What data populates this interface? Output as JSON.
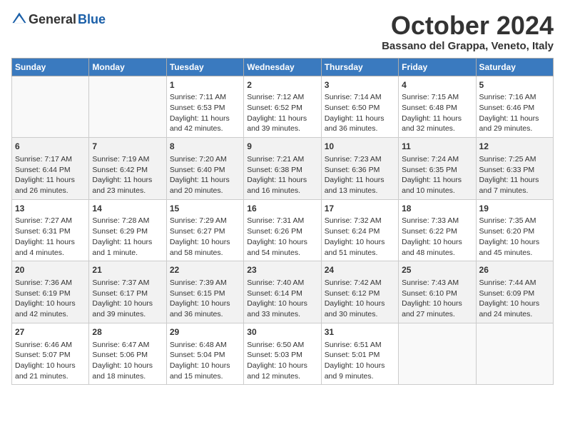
{
  "header": {
    "logo_general": "General",
    "logo_blue": "Blue",
    "month": "October 2024",
    "location": "Bassano del Grappa, Veneto, Italy"
  },
  "weekdays": [
    "Sunday",
    "Monday",
    "Tuesday",
    "Wednesday",
    "Thursday",
    "Friday",
    "Saturday"
  ],
  "weeks": [
    [
      {
        "day": "",
        "sunrise": "",
        "sunset": "",
        "daylight": ""
      },
      {
        "day": "",
        "sunrise": "",
        "sunset": "",
        "daylight": ""
      },
      {
        "day": "1",
        "sunrise": "Sunrise: 7:11 AM",
        "sunset": "Sunset: 6:53 PM",
        "daylight": "Daylight: 11 hours and 42 minutes."
      },
      {
        "day": "2",
        "sunrise": "Sunrise: 7:12 AM",
        "sunset": "Sunset: 6:52 PM",
        "daylight": "Daylight: 11 hours and 39 minutes."
      },
      {
        "day": "3",
        "sunrise": "Sunrise: 7:14 AM",
        "sunset": "Sunset: 6:50 PM",
        "daylight": "Daylight: 11 hours and 36 minutes."
      },
      {
        "day": "4",
        "sunrise": "Sunrise: 7:15 AM",
        "sunset": "Sunset: 6:48 PM",
        "daylight": "Daylight: 11 hours and 32 minutes."
      },
      {
        "day": "5",
        "sunrise": "Sunrise: 7:16 AM",
        "sunset": "Sunset: 6:46 PM",
        "daylight": "Daylight: 11 hours and 29 minutes."
      }
    ],
    [
      {
        "day": "6",
        "sunrise": "Sunrise: 7:17 AM",
        "sunset": "Sunset: 6:44 PM",
        "daylight": "Daylight: 11 hours and 26 minutes."
      },
      {
        "day": "7",
        "sunrise": "Sunrise: 7:19 AM",
        "sunset": "Sunset: 6:42 PM",
        "daylight": "Daylight: 11 hours and 23 minutes."
      },
      {
        "day": "8",
        "sunrise": "Sunrise: 7:20 AM",
        "sunset": "Sunset: 6:40 PM",
        "daylight": "Daylight: 11 hours and 20 minutes."
      },
      {
        "day": "9",
        "sunrise": "Sunrise: 7:21 AM",
        "sunset": "Sunset: 6:38 PM",
        "daylight": "Daylight: 11 hours and 16 minutes."
      },
      {
        "day": "10",
        "sunrise": "Sunrise: 7:23 AM",
        "sunset": "Sunset: 6:36 PM",
        "daylight": "Daylight: 11 hours and 13 minutes."
      },
      {
        "day": "11",
        "sunrise": "Sunrise: 7:24 AM",
        "sunset": "Sunset: 6:35 PM",
        "daylight": "Daylight: 11 hours and 10 minutes."
      },
      {
        "day": "12",
        "sunrise": "Sunrise: 7:25 AM",
        "sunset": "Sunset: 6:33 PM",
        "daylight": "Daylight: 11 hours and 7 minutes."
      }
    ],
    [
      {
        "day": "13",
        "sunrise": "Sunrise: 7:27 AM",
        "sunset": "Sunset: 6:31 PM",
        "daylight": "Daylight: 11 hours and 4 minutes."
      },
      {
        "day": "14",
        "sunrise": "Sunrise: 7:28 AM",
        "sunset": "Sunset: 6:29 PM",
        "daylight": "Daylight: 11 hours and 1 minute."
      },
      {
        "day": "15",
        "sunrise": "Sunrise: 7:29 AM",
        "sunset": "Sunset: 6:27 PM",
        "daylight": "Daylight: 10 hours and 58 minutes."
      },
      {
        "day": "16",
        "sunrise": "Sunrise: 7:31 AM",
        "sunset": "Sunset: 6:26 PM",
        "daylight": "Daylight: 10 hours and 54 minutes."
      },
      {
        "day": "17",
        "sunrise": "Sunrise: 7:32 AM",
        "sunset": "Sunset: 6:24 PM",
        "daylight": "Daylight: 10 hours and 51 minutes."
      },
      {
        "day": "18",
        "sunrise": "Sunrise: 7:33 AM",
        "sunset": "Sunset: 6:22 PM",
        "daylight": "Daylight: 10 hours and 48 minutes."
      },
      {
        "day": "19",
        "sunrise": "Sunrise: 7:35 AM",
        "sunset": "Sunset: 6:20 PM",
        "daylight": "Daylight: 10 hours and 45 minutes."
      }
    ],
    [
      {
        "day": "20",
        "sunrise": "Sunrise: 7:36 AM",
        "sunset": "Sunset: 6:19 PM",
        "daylight": "Daylight: 10 hours and 42 minutes."
      },
      {
        "day": "21",
        "sunrise": "Sunrise: 7:37 AM",
        "sunset": "Sunset: 6:17 PM",
        "daylight": "Daylight: 10 hours and 39 minutes."
      },
      {
        "day": "22",
        "sunrise": "Sunrise: 7:39 AM",
        "sunset": "Sunset: 6:15 PM",
        "daylight": "Daylight: 10 hours and 36 minutes."
      },
      {
        "day": "23",
        "sunrise": "Sunrise: 7:40 AM",
        "sunset": "Sunset: 6:14 PM",
        "daylight": "Daylight: 10 hours and 33 minutes."
      },
      {
        "day": "24",
        "sunrise": "Sunrise: 7:42 AM",
        "sunset": "Sunset: 6:12 PM",
        "daylight": "Daylight: 10 hours and 30 minutes."
      },
      {
        "day": "25",
        "sunrise": "Sunrise: 7:43 AM",
        "sunset": "Sunset: 6:10 PM",
        "daylight": "Daylight: 10 hours and 27 minutes."
      },
      {
        "day": "26",
        "sunrise": "Sunrise: 7:44 AM",
        "sunset": "Sunset: 6:09 PM",
        "daylight": "Daylight: 10 hours and 24 minutes."
      }
    ],
    [
      {
        "day": "27",
        "sunrise": "Sunrise: 6:46 AM",
        "sunset": "Sunset: 5:07 PM",
        "daylight": "Daylight: 10 hours and 21 minutes."
      },
      {
        "day": "28",
        "sunrise": "Sunrise: 6:47 AM",
        "sunset": "Sunset: 5:06 PM",
        "daylight": "Daylight: 10 hours and 18 minutes."
      },
      {
        "day": "29",
        "sunrise": "Sunrise: 6:48 AM",
        "sunset": "Sunset: 5:04 PM",
        "daylight": "Daylight: 10 hours and 15 minutes."
      },
      {
        "day": "30",
        "sunrise": "Sunrise: 6:50 AM",
        "sunset": "Sunset: 5:03 PM",
        "daylight": "Daylight: 10 hours and 12 minutes."
      },
      {
        "day": "31",
        "sunrise": "Sunrise: 6:51 AM",
        "sunset": "Sunset: 5:01 PM",
        "daylight": "Daylight: 10 hours and 9 minutes."
      },
      {
        "day": "",
        "sunrise": "",
        "sunset": "",
        "daylight": ""
      },
      {
        "day": "",
        "sunrise": "",
        "sunset": "",
        "daylight": ""
      }
    ]
  ]
}
